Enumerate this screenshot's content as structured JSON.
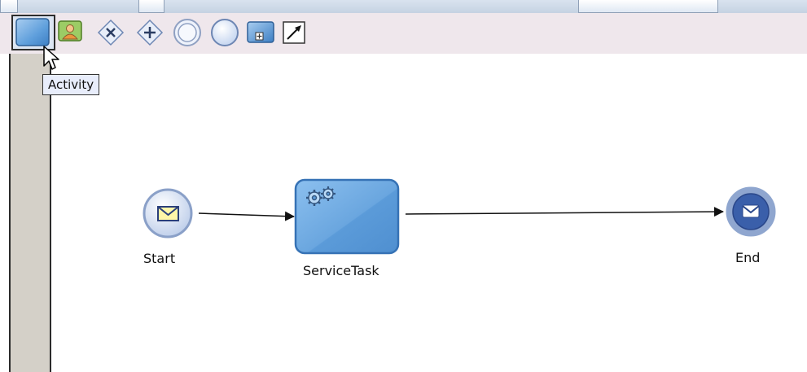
{
  "palette": {
    "tools": [
      {
        "name": "activity",
        "icon": "activity-icon"
      },
      {
        "name": "user-task",
        "icon": "user-task-icon"
      },
      {
        "name": "exclusive-gateway",
        "icon": "exclusive-gateway-icon"
      },
      {
        "name": "parallel-gateway",
        "icon": "parallel-gateway-icon"
      },
      {
        "name": "intermediate-event",
        "icon": "intermediate-event-icon"
      },
      {
        "name": "event",
        "icon": "event-icon"
      },
      {
        "name": "subprocess",
        "icon": "subprocess-icon"
      },
      {
        "name": "connector",
        "icon": "connector-icon"
      }
    ],
    "tooltip": "Activity"
  },
  "diagram": {
    "start_label": "Start",
    "task_label": "ServiceTask",
    "end_label": "End"
  },
  "colors": {
    "toolbar_bg": "#efe7ec",
    "activity_blue": "#6aa6df",
    "event_blue": "#5e84c8",
    "rail_gray": "#d4d0c8"
  }
}
